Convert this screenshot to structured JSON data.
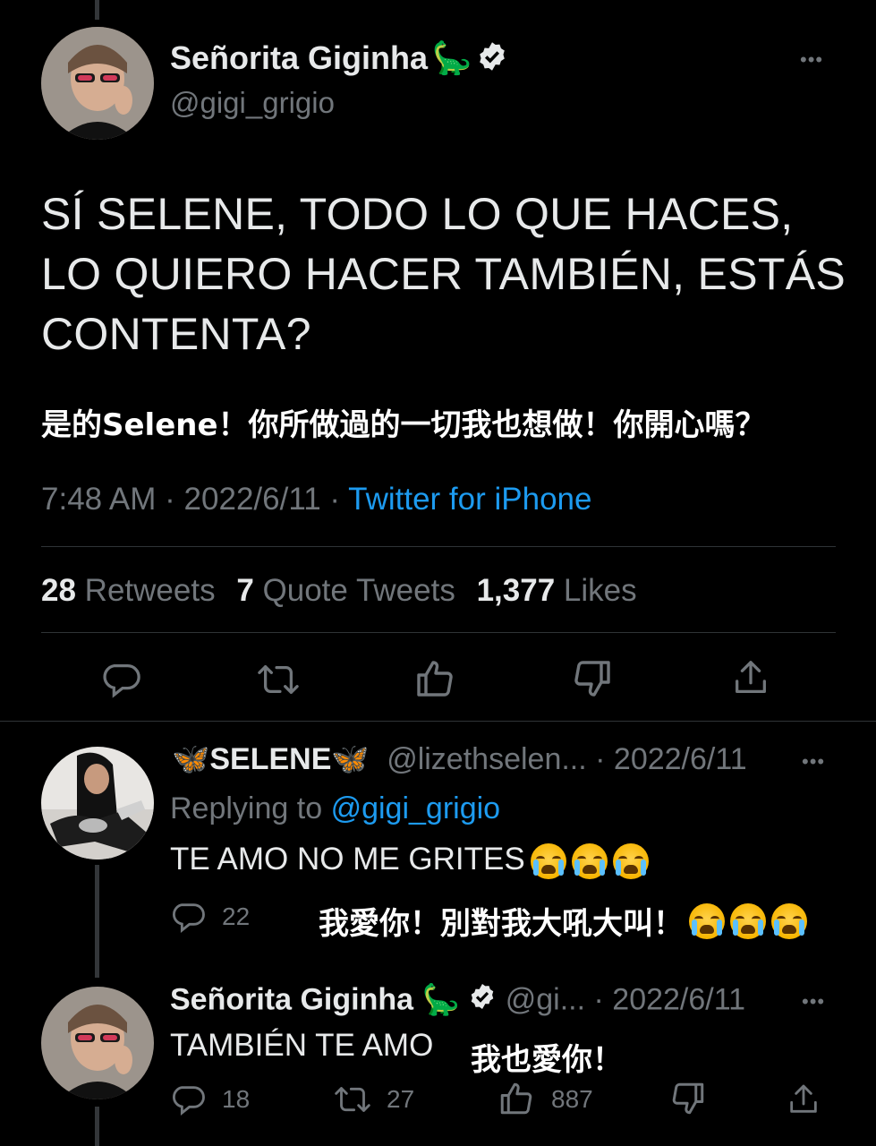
{
  "main_tweet": {
    "display_name": "Señorita Giginha",
    "name_emoji": "🦕",
    "handle": "@gigi_grigio",
    "text": "SÍ SELENE, TODO LO QUE HACES, LO QUIERO HACER TAMBIÉN, ESTÁS CONTENTA?",
    "translation": "是的Selene！你所做過的一切我也想做！你開心嗎？",
    "time": "7:48 AM",
    "date": "2022/6/11",
    "source": "Twitter for iPhone",
    "retweets_count": "28",
    "retweets_label": "Retweets",
    "quotes_count": "7",
    "quotes_label": "Quote Tweets",
    "likes_count": "1,377",
    "likes_label": "Likes"
  },
  "reply_1": {
    "butterfly": "🦋",
    "display_name": "SELENE",
    "handle": "@lizethselen...",
    "date": "· 2022/6/11",
    "replying_to_label": "Replying to",
    "replying_to_handle": "@gigi_grigio",
    "text": "TE AMO NO ME GRITES",
    "translation": "我愛你！別對我大吼大叫！",
    "reply_count": "22"
  },
  "reply_2": {
    "display_name": "Señorita Giginha",
    "name_emoji": "🦕",
    "handle": "@gi...",
    "date": "· 2022/6/11",
    "text": "TAMBIÉN TE AMO",
    "translation": "我也愛你！",
    "reply_count": "18",
    "retweet_count": "27",
    "like_count": "887"
  },
  "more_glyph": "•••",
  "colors": {
    "background": "#000000",
    "text": "#e7e9ea",
    "muted": "#71767b",
    "link": "#1d9bf0",
    "divider": "#2f3336"
  }
}
